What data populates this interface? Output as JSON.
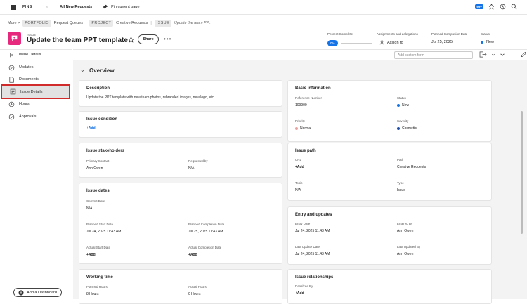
{
  "topbar": {
    "pins": "PINS",
    "tab": "All New Requests",
    "pin_current": "Pin current page",
    "badge": "99+"
  },
  "breadcrumb": {
    "more": "More >",
    "items": [
      "PORTFOLIO",
      "Request Queues",
      "PROJECT",
      "Creative Requests",
      "ISSUE"
    ],
    "current": "Update the team PP.."
  },
  "header": {
    "type": "ISSUE",
    "title": "Update the team PPT template",
    "share": "Share",
    "more": "•••",
    "percent_label": "Percent Complete",
    "percent_value": "0%",
    "percent": 0,
    "assign_label": "Assignments and delegations",
    "assign_value": "Assign to",
    "planned_label": "Planned Completion Date",
    "planned_value": "Jul 25, 2025",
    "status_label": "Status",
    "status_value": "New"
  },
  "sidebar": {
    "head": "Issue Details",
    "items": [
      {
        "label": "Updates"
      },
      {
        "label": "Documents"
      },
      {
        "label": "Issue Details"
      },
      {
        "label": "Hours"
      },
      {
        "label": "Approvals"
      }
    ],
    "dashboard": "Add a Dashboard"
  },
  "toolbar": {
    "custom_form": "Add custom form"
  },
  "overview": "Overview",
  "cards": {
    "description": {
      "title": "Description",
      "text": "Update the PPT template with new team photos, rebranded images, new logo, etc."
    },
    "condition": {
      "title": "Issue condition",
      "add": "+Add"
    },
    "stakeholders": {
      "title": "Issue stakeholders",
      "primary_label": "Primary Contact",
      "primary_value": "Ann Owen",
      "requested_label": "Requested by",
      "requested_value": "N/A"
    },
    "dates": {
      "title": "Issue dates",
      "commit_label": "Commit Date",
      "commit_value": "N/A",
      "pstart_label": "Planned Start Date",
      "pstart_value": "Jul 24, 2025 11:43 AM",
      "pcomp_label": "Planned Completion Date",
      "pcomp_value": "Jul 25, 2025 11:43 AM",
      "astart_label": "Actual Start Date",
      "astart_value": "+Add",
      "acomp_label": "Actual Completion Date",
      "acomp_value": "+Add"
    },
    "working": {
      "title": "Working time",
      "planned_label": "Planned Hours",
      "planned_value": "8 Hours",
      "actual_label": "Actual Hours",
      "actual_value": "0 Hours"
    },
    "basic": {
      "title": "Basic information",
      "ref_label": "Reference Number",
      "ref_value": "109900",
      "status_label": "Status",
      "status_value": "New",
      "priority_label": "Priority",
      "priority_value": "Normal",
      "severity_label": "Severity",
      "severity_value": "Cosmetic"
    },
    "path": {
      "title": "Issue path",
      "url_label": "URL",
      "url_value": "+Add",
      "path_label": "Path",
      "path_value": "Creative Requests",
      "topic_label": "Topic",
      "topic_value": "N/A",
      "type_label": "Type",
      "type_value": "Issue"
    },
    "entry": {
      "title": "Entry and updates",
      "entry_label": "Entry Date",
      "entry_value": "Jul 24, 2025 11:43 AM",
      "enteredby_label": "Entered By",
      "enteredby_value": "Ann Owen",
      "lastdate_label": "Last Update Date",
      "lastdate_value": "Jul 24, 2025 11:43 AM",
      "lastby_label": "Last Updated By",
      "lastby_value": "Ann Owen"
    },
    "relationships": {
      "title": "Issue relationships",
      "resolved_label": "Resolved By",
      "resolved_value": "+Add"
    }
  },
  "colors": {
    "accent": "#1473e6",
    "brand": "#e7297e",
    "highlight": "#d12b2b",
    "status_new": "#1473e6",
    "priority_normal": "#e8a2a2",
    "severity_cosmetic": "#1f4fa8"
  }
}
